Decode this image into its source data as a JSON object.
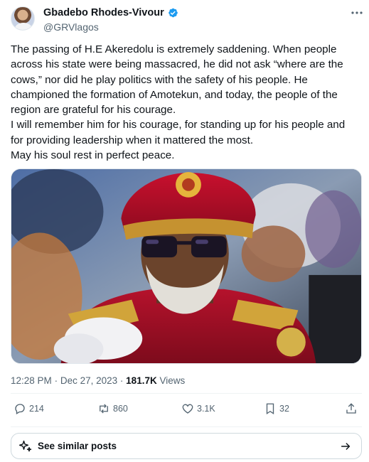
{
  "author": {
    "display_name": "Gbadebo Rhodes-Vivour",
    "handle": "@GRVlagos",
    "verified": true,
    "verified_color": "#1d9bf0"
  },
  "tweet": {
    "lines": [
      "The passing of H.E Akeredolu is extremely saddening. When people",
      "across his state were being massacred, he did not ask “where are the",
      "cows,” nor did he play politics with the safety of his people. He",
      "championed the formation of Amotekun, and today, the people of the",
      "region are grateful for his courage.",
      "I will remember him for his courage, for standing up for his people and",
      "for providing leadership when it mattered the most.",
      "May his soul rest in perfect peace."
    ]
  },
  "meta": {
    "time": "12:28 PM",
    "separator": "·",
    "date": "Dec 27, 2023",
    "views_count": "181.7K",
    "views_label": "Views"
  },
  "actions": {
    "replies": "214",
    "reposts": "860",
    "likes": "3.1K",
    "bookmarks": "32"
  },
  "similar": {
    "label": "See similar posts"
  },
  "icons": {
    "more": "more-horizontal-icon",
    "reply": "reply-icon",
    "repost": "repost-icon",
    "like": "heart-icon",
    "bookmark": "bookmark-icon",
    "share": "share-icon",
    "sparkle": "sparkle-icon",
    "arrow": "arrow-right-icon"
  }
}
